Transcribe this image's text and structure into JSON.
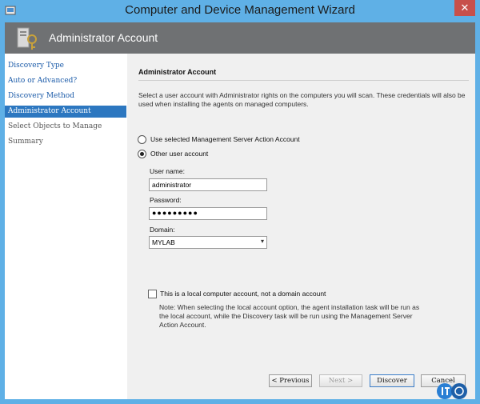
{
  "window": {
    "title": "Computer and Device Management Wizard",
    "close_label": "✕"
  },
  "header": {
    "title": "Administrator Account"
  },
  "sidebar": {
    "items": [
      {
        "label": "Discovery Type"
      },
      {
        "label": "Auto or Advanced?"
      },
      {
        "label": "Discovery Method"
      },
      {
        "label": "Administrator Account"
      },
      {
        "label": "Select Objects to Manage"
      },
      {
        "label": "Summary"
      }
    ]
  },
  "content": {
    "section_title": "Administrator Account",
    "description": "Select a user account with Administrator rights on the computers you will scan. These credentials will also be used when installing the agents on managed computers.",
    "radio_selected_account": "Use selected Management Server Action Account",
    "radio_other_account": "Other user account",
    "username_label": "User name:",
    "username_value": "administrator",
    "password_label": "Password:",
    "password_value": "●●●●●●●●●",
    "domain_label": "Domain:",
    "domain_value": "MYLAB",
    "local_account_label": "This is a local computer account, not a domain account",
    "note": "Note:  When selecting the local account option, the agent installation task will be run as the local account, while the Discovery task will be run using the Management Server Action Account."
  },
  "footer": {
    "previous_label": "< Previous",
    "next_label": "Next >",
    "discover_label": "Discover",
    "cancel_label": "Cancel"
  }
}
